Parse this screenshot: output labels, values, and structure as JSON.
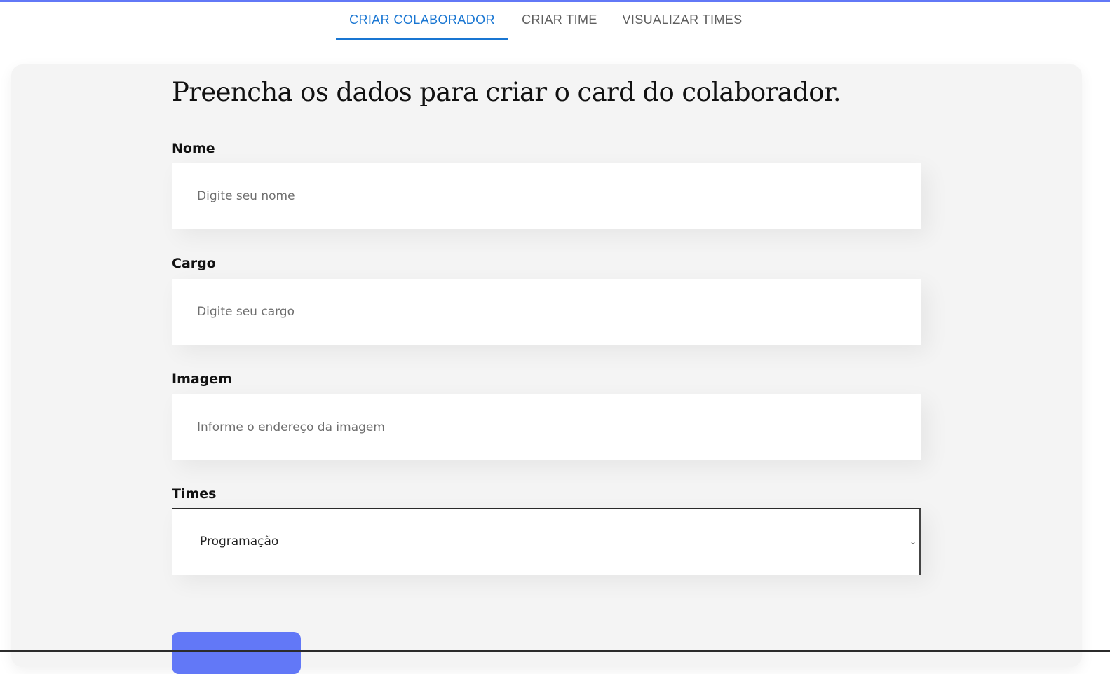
{
  "nav": {
    "tabs": [
      {
        "label": "CRIAR COLABORADOR",
        "active": true
      },
      {
        "label": "CRIAR TIME",
        "active": false
      },
      {
        "label": "VISUALIZAR TIMES",
        "active": false
      }
    ]
  },
  "form": {
    "title": "Preencha os dados para criar o card do colaborador.",
    "fields": [
      {
        "label": "Nome",
        "placeholder": "Digite seu nome",
        "value": ""
      },
      {
        "label": "Cargo",
        "placeholder": "Digite seu cargo",
        "value": ""
      },
      {
        "label": "Imagem",
        "placeholder": "Informe o endereço da imagem",
        "value": ""
      }
    ],
    "select": {
      "label": "Times",
      "selected": "Programação",
      "arrow_icon": "chevron-down-icon"
    },
    "submit_button": {
      "label": ""
    }
  },
  "colors": {
    "accent": "#6278f7",
    "active_tab": "#1976d2",
    "inactive_tab": "#5f5f5f",
    "panel_background": "#f4f4f4"
  }
}
